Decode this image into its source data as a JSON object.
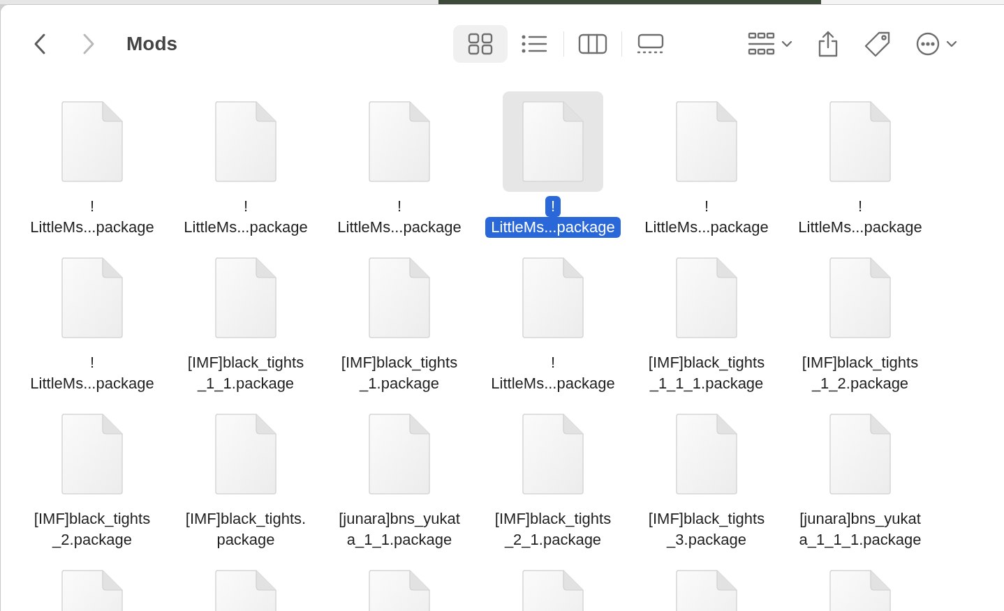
{
  "toolbar": {
    "title": "Mods",
    "back": {
      "disabled": false
    },
    "forward": {
      "disabled": true
    },
    "views": [
      {
        "kind": "icons",
        "selected": true
      },
      {
        "kind": "list",
        "selected": false
      },
      {
        "kind": "columns",
        "selected": false
      },
      {
        "kind": "gallery",
        "selected": false
      }
    ]
  },
  "files": [
    {
      "lines": [
        "!",
        "LittleMs...package"
      ],
      "selected": false
    },
    {
      "lines": [
        "!",
        "LittleMs...package"
      ],
      "selected": false
    },
    {
      "lines": [
        "!",
        "LittleMs...package"
      ],
      "selected": false
    },
    {
      "lines": [
        "!",
        "LittleMs...package"
      ],
      "selected": true
    },
    {
      "lines": [
        "!",
        "LittleMs...package"
      ],
      "selected": false
    },
    {
      "lines": [
        "!",
        "LittleMs...package"
      ],
      "selected": false
    },
    {
      "lines": [
        "!",
        "LittleMs...package"
      ],
      "selected": false
    },
    {
      "lines": [
        "[IMF]black_tights",
        "_1_1.package"
      ],
      "selected": false
    },
    {
      "lines": [
        "[IMF]black_tights",
        "_1.package"
      ],
      "selected": false
    },
    {
      "lines": [
        "!",
        "LittleMs...package"
      ],
      "selected": false
    },
    {
      "lines": [
        "[IMF]black_tights",
        "_1_1_1.package"
      ],
      "selected": false
    },
    {
      "lines": [
        "[IMF]black_tights",
        "_1_2.package"
      ],
      "selected": false
    },
    {
      "lines": [
        "[IMF]black_tights",
        "_2.package"
      ],
      "selected": false
    },
    {
      "lines": [
        "[IMF]black_tights.",
        "package"
      ],
      "selected": false
    },
    {
      "lines": [
        "[junara]bns_yukat",
        "a_1_1.package"
      ],
      "selected": false
    },
    {
      "lines": [
        "[IMF]black_tights",
        "_2_1.package"
      ],
      "selected": false
    },
    {
      "lines": [
        "[IMF]black_tights",
        "_3.package"
      ],
      "selected": false
    },
    {
      "lines": [
        "[junara]bns_yukat",
        "a_1_1_1.package"
      ],
      "selected": false
    },
    {
      "selected": false
    },
    {
      "selected": false
    },
    {
      "selected": false
    },
    {
      "selected": false
    },
    {
      "selected": false
    },
    {
      "selected": false
    }
  ]
}
